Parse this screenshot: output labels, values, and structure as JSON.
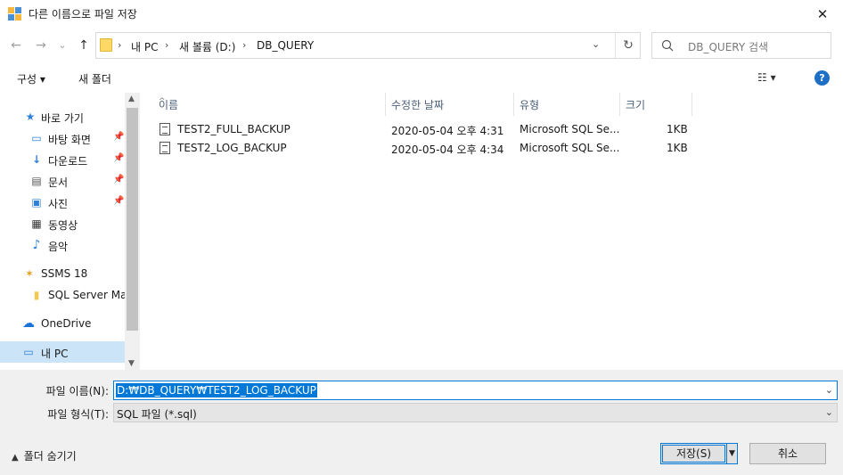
{
  "window": {
    "title": "다른 이름으로 파일 저장",
    "close_glyph": "✕"
  },
  "nav": {
    "back": "←",
    "forward": "→",
    "recent": "⌄",
    "up": "↑"
  },
  "address": {
    "crumbs": [
      "내 PC",
      "새 볼륨 (D:)",
      "DB_QUERY"
    ],
    "sep": "›",
    "dropdown": "⌄",
    "refresh": "↻"
  },
  "search": {
    "placeholder": "DB_QUERY 검색",
    "icon": "search-icon"
  },
  "toolbar": {
    "organize": "구성 ▾",
    "new_folder": "새 폴더",
    "view": "☷ ▾",
    "help": "?"
  },
  "sidebar": {
    "items": [
      {
        "label": "바로 가기",
        "icon": "★"
      },
      {
        "label": "바탕 화면",
        "icon": "▭",
        "pin": "📌"
      },
      {
        "label": "다운로드",
        "icon": "↓",
        "pin": "📌"
      },
      {
        "label": "문서",
        "icon": "▤",
        "pin": "📌"
      },
      {
        "label": "사진",
        "icon": "▣",
        "pin": "📌"
      },
      {
        "label": "동영상",
        "icon": "▦"
      },
      {
        "label": "음악",
        "icon": "♪"
      },
      {
        "label": "SSMS 18",
        "icon": "✶"
      },
      {
        "label": "SQL Server Man",
        "icon": "▮"
      },
      {
        "label": "OneDrive",
        "icon": "☁"
      },
      {
        "label": "내 PC",
        "icon": "▭"
      }
    ],
    "scroll_up": "▲",
    "scroll_down": "▼"
  },
  "columns": {
    "name": "이름",
    "modified": "수정한 날짜",
    "type": "유형",
    "size": "크기",
    "sort_glyph": "^"
  },
  "files": [
    {
      "name": "TEST2_FULL_BACKUP",
      "modified": "2020-05-04 오후 4:31",
      "type": "Microsoft SQL Se...",
      "size": "1KB"
    },
    {
      "name": "TEST2_LOG_BACKUP",
      "modified": "2020-05-04 오후 4:34",
      "type": "Microsoft SQL Se...",
      "size": "1KB"
    }
  ],
  "form": {
    "filename_label": "파일 이름(N):",
    "filename_value": "D:₩DB_QUERY₩TEST2_LOG_BACKUP",
    "filetype_label": "파일 형식(T):",
    "filetype_value": "SQL 파일 (*.sql)",
    "dropdown": "⌄"
  },
  "footer": {
    "hide_folders": "폴더 숨기기",
    "hide_chevron": "▲",
    "save": "저장(S)",
    "save_split": "▼",
    "cancel": "취소"
  },
  "colors": {
    "accent": "#0078d7",
    "selected": "#cce4f7",
    "folder": "#ffd866"
  }
}
